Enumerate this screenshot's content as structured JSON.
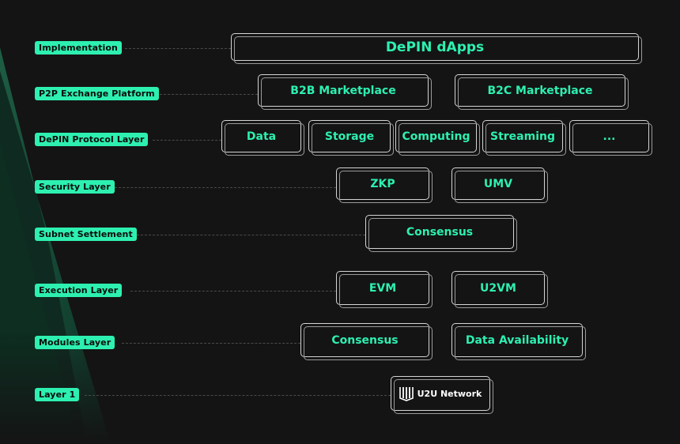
{
  "layers": [
    {
      "label": "Implementation",
      "items": [
        "DePIN dApps"
      ]
    },
    {
      "label": "P2P Exchange Platform",
      "items": [
        "B2B Marketplace",
        "B2C Marketplace"
      ]
    },
    {
      "label": "DePIN Protocol Layer",
      "items": [
        "Data",
        "Storage",
        "Computing",
        "Streaming",
        "..."
      ]
    },
    {
      "label": "Security Layer",
      "items": [
        "ZKP",
        "UMV"
      ]
    },
    {
      "label": "Subnet Settlement",
      "items": [
        "Consensus"
      ]
    },
    {
      "label": "Execution Layer",
      "items": [
        "EVM",
        "U2VM"
      ]
    },
    {
      "label": "Modules Layer",
      "items": [
        "Consensus",
        "Data Availability"
      ]
    },
    {
      "label": "Layer 1",
      "items": [
        "U2U Network"
      ]
    }
  ],
  "colors": {
    "accent": "#2df0b0",
    "background": "#141414",
    "box_border": "#d4d4d4"
  },
  "icons": {
    "network_logo": "u2u-logo-icon"
  }
}
